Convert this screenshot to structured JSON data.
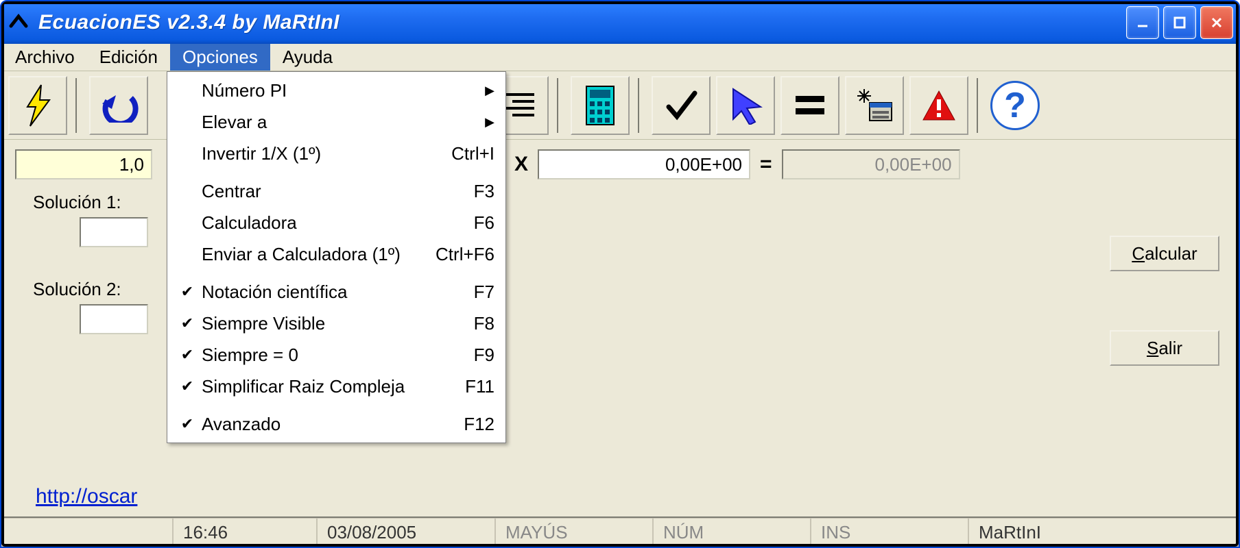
{
  "window": {
    "title": "EcuacionES v2.3.4 by MaRtInI"
  },
  "menubar": {
    "archivo": "Archivo",
    "edicion": "Edición",
    "opciones": "Opciones",
    "ayuda": "Ayuda"
  },
  "dropdown": {
    "numero_pi": "Número PI",
    "elevar_a": "Elevar a",
    "invertir": {
      "label": "Invertir 1/X (1º)",
      "accel": "Ctrl+I"
    },
    "centrar": {
      "label": "Centrar",
      "accel": "F3"
    },
    "calculadora": {
      "label": "Calculadora",
      "accel": "F6"
    },
    "enviar_calc": {
      "label": "Enviar a Calculadora (1º)",
      "accel": "Ctrl+F6"
    },
    "notacion": {
      "label": "Notación científica",
      "accel": "F7",
      "checked": true
    },
    "siempre_visible": {
      "label": "Siempre Visible",
      "accel": "F8",
      "checked": true
    },
    "siempre_cero": {
      "label": "Siempre = 0",
      "accel": "F9",
      "checked": true
    },
    "simplificar": {
      "label": "Simplificar Raiz Compleja",
      "accel": "F11",
      "checked": true
    },
    "avanzado": {
      "label": "Avanzado",
      "accel": "F12",
      "checked": true
    }
  },
  "equation": {
    "coef_a_partial": "1,0",
    "x_label": "X",
    "coef_c": "0,00E+00",
    "equals": "=",
    "result": "0,00E+00"
  },
  "solutions": {
    "sol1_label": "Solución 1:",
    "sol2_label": "Solución 2:",
    "sol1_value": "",
    "sol2_value": ""
  },
  "buttons": {
    "calcular": "Calcular",
    "salir": "Salir"
  },
  "link": {
    "text": "http://oscar"
  },
  "status": {
    "time": "16:46",
    "date": "03/08/2005",
    "mayus": "MAYÚS",
    "num": "NÚM",
    "ins": "INS",
    "author": "MaRtInI"
  },
  "toolbar_icons": [
    "lightning",
    "undo",
    "hidden1",
    "hidden2",
    "hidden3",
    "hidden4",
    "hidden5",
    "align-right",
    "calculator",
    "check",
    "cursor",
    "equals",
    "sparkle-window",
    "warning",
    "help"
  ]
}
